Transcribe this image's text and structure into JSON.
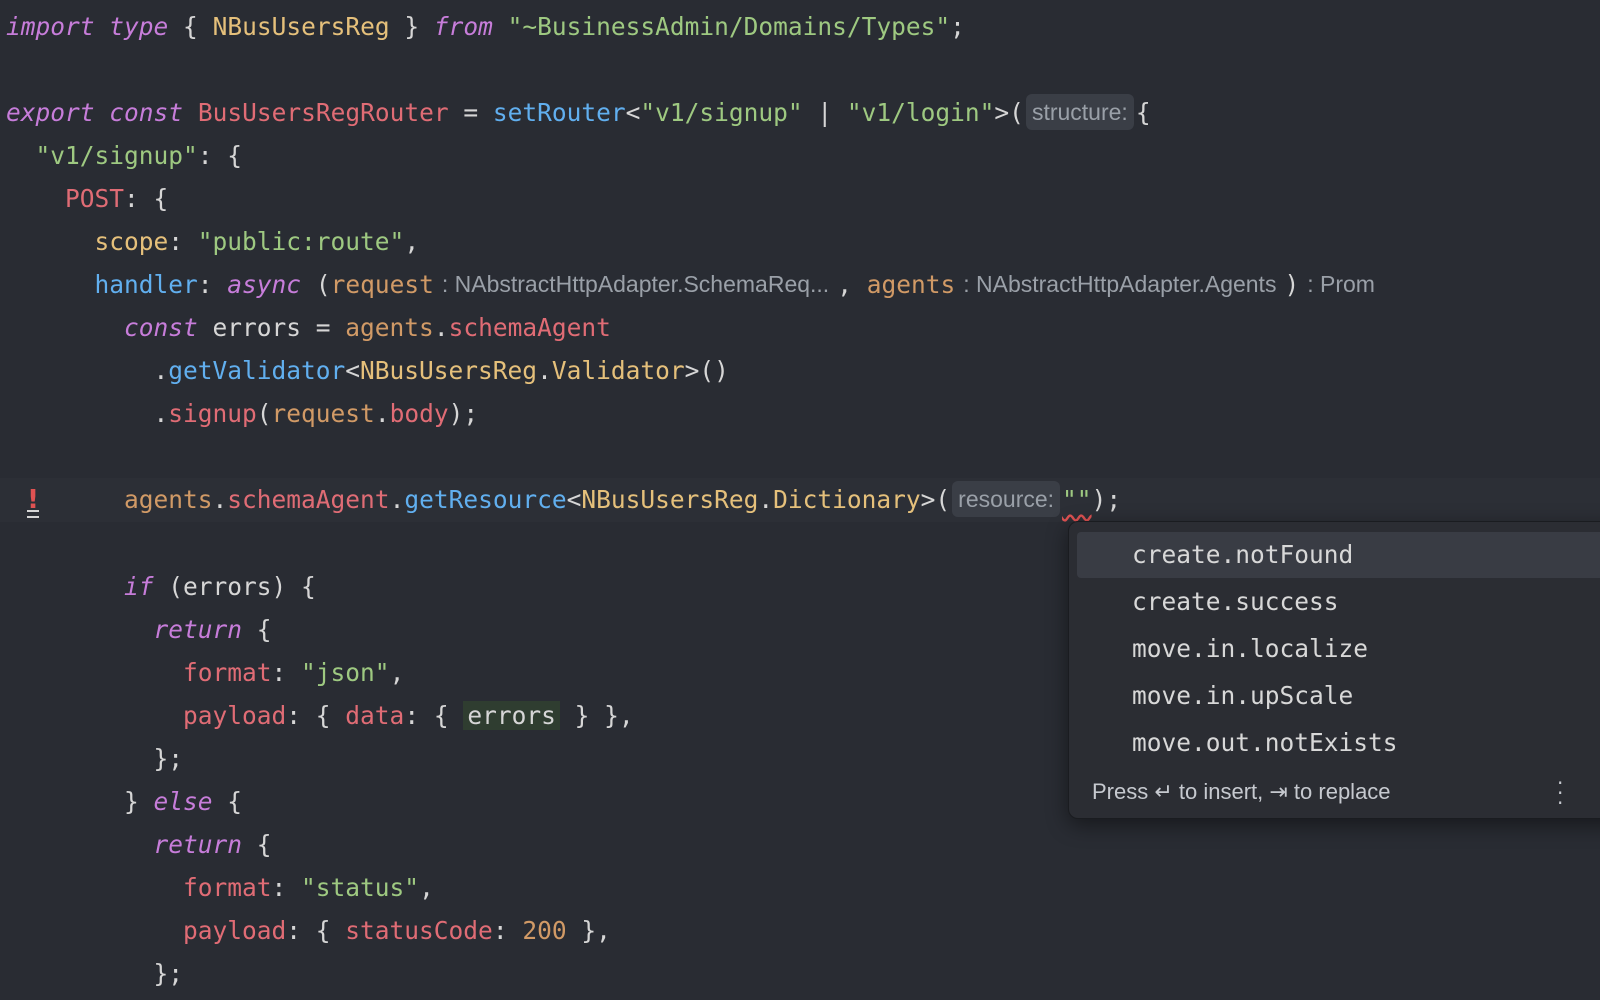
{
  "editor": {
    "line1": {
      "t1": "import",
      "t2": " ",
      "t3": "type",
      "t4": " { ",
      "t5": "NBusUsersReg",
      "t6": " } ",
      "t7": "from",
      "t8": " ",
      "t9": "\"~BusinessAdmin/Domains/Types\"",
      "t10": ";"
    },
    "line3": {
      "t1": "export",
      "t2": " ",
      "t3": "const",
      "t4": " ",
      "t5": "BusUsersRegRouter",
      "t6": " = ",
      "t7": "setRouter",
      "t8": "<",
      "t9": "\"v1/signup\"",
      "t10": " | ",
      "t11": "\"v1/login\"",
      "t12": ">(",
      "hint": "structure:",
      "t13": "{"
    },
    "line4": {
      "t1": "  ",
      "t2": "\"v1/signup\"",
      "t3": ": {"
    },
    "line5": {
      "t1": "    ",
      "t2": "POST",
      "t3": ": {"
    },
    "line6": {
      "t1": "      ",
      "t2": "scope",
      "t3": ": ",
      "t4": "\"public:route\"",
      "t5": ","
    },
    "line7": {
      "t1": "      ",
      "t2": "handler",
      "t3": ": ",
      "t4": "async",
      "t5": " (",
      "t6": "request",
      "h1": ": NAbstractHttpAdapter.SchemaReq...",
      "t7": ", ",
      "t8": "agents",
      "h2": ": NAbstractHttpAdapter.Agents",
      "t9": ")",
      "h3": ": Prom"
    },
    "line8": {
      "t1": "        ",
      "t2": "const",
      "t3": " errors = ",
      "t4": "agents",
      "t5": ".",
      "t6": "schemaAgent"
    },
    "line9": {
      "t1": "          .",
      "t2": "getValidator",
      "t3": "<",
      "t4": "NBusUsersReg",
      "t5": ".",
      "t6": "Validator",
      "t7": ">()"
    },
    "line10": {
      "t1": "          .",
      "t2": "signup",
      "t3": "(",
      "t4": "request",
      "t5": ".",
      "t6": "body",
      "t7": ");"
    },
    "line12": {
      "t1": "        ",
      "t2": "agents",
      "t3": ".",
      "t4": "schemaAgent",
      "t5": ".",
      "t6": "getResource",
      "t7": "<",
      "t8": "NBusUsersReg",
      "t9": ".",
      "t10": "Dictionary",
      "t11": ">(",
      "hint": "resource:",
      "t12": "\"\"",
      "t13": ");"
    },
    "line14": {
      "t1": "        ",
      "t2": "if",
      "t3": " (errors) {"
    },
    "line15": {
      "t1": "          ",
      "t2": "return",
      "t3": " {"
    },
    "line16": {
      "t1": "            ",
      "t2": "format",
      "t3": ": ",
      "t4": "\"json\"",
      "t5": ","
    },
    "line17": {
      "t1": "            ",
      "t2": "payload",
      "t3": ": { ",
      "t4": "data",
      "t5": ": { ",
      "t6": "errors",
      "t7": " } },"
    },
    "line18": {
      "t1": "          };"
    },
    "line19": {
      "t1": "        } ",
      "t2": "else",
      "t3": " {"
    },
    "line20": {
      "t1": "          ",
      "t2": "return",
      "t3": " {"
    },
    "line21": {
      "t1": "            ",
      "t2": "format",
      "t3": ": ",
      "t4": "\"status\"",
      "t5": ","
    },
    "line22": {
      "t1": "            ",
      "t2": "payload",
      "t3": ": { ",
      "t4": "statusCode",
      "t5": ": ",
      "t6": "200",
      "t7": " },"
    },
    "line23": {
      "t1": "          };"
    }
  },
  "completion": {
    "items": [
      "create.notFound",
      "create.success",
      "move.in.localize",
      "move.in.upScale",
      "move.out.notExists"
    ],
    "footer": "Press ↵ to insert, ⇥ to replace"
  },
  "icons": {
    "gutter": "error-bulb-icon",
    "more": "more-vertical-icon"
  },
  "colors": {
    "background": "#292c33",
    "keyword": "#c77dda",
    "string": "#9ec981",
    "type": "#e5c07b",
    "function": "#61afef",
    "property": "#e06c75",
    "parameter": "#d19a66",
    "error": "#e05252"
  }
}
